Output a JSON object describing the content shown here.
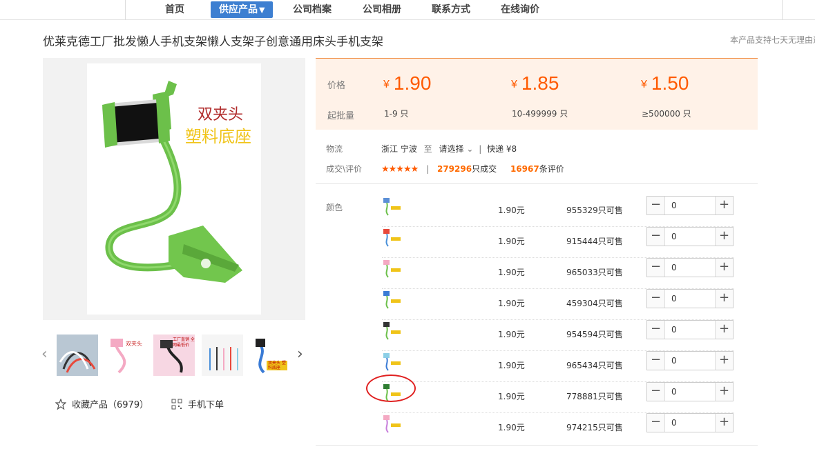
{
  "nav": {
    "items": [
      "首页",
      "供应产品",
      "公司档案",
      "公司相册",
      "联系方式",
      "在线询价"
    ],
    "active_arrow": "▼"
  },
  "product": {
    "title": "优莱克德工厂批发懒人手机支架懒人支架子创意通用床头手机支架",
    "side_note": "本产品支持七天无理由退"
  },
  "main_image": {
    "caption_line1": "双夹头",
    "caption_line2": "塑料底座"
  },
  "thumbnails": {
    "prev_icon": "chevron-left-icon",
    "next_icon": "chevron-right-icon",
    "thumb2_text": "双夹头",
    "thumb3_text": "工厂直销 全网最低价",
    "thumb5_text": "双夹头 塑料底座"
  },
  "actions": {
    "favorite_icon": "star-outline-icon",
    "favorite_label": "收藏产品（6979）",
    "mobile_icon": "qr-code-icon",
    "mobile_label": "手机下单"
  },
  "pricing": {
    "price_label": "价格",
    "min_label": "起批量",
    "currency": "¥",
    "tiers": [
      {
        "price": "1.90",
        "qty": "1-9 只"
      },
      {
        "price": "1.85",
        "qty": "10-499999 只"
      },
      {
        "price": "1.50",
        "qty": "≥500000 只"
      }
    ]
  },
  "logistics": {
    "label": "物流",
    "origin": "浙江 宁波",
    "to": "至",
    "destination": "请选择",
    "shipping": "快递 ¥8"
  },
  "deals": {
    "label": "成交\\评价",
    "stars": "★★★★★",
    "rating": 4.5,
    "sold_count": "279296",
    "sold_suffix": "只成交",
    "review_count": "16967",
    "review_suffix": "条评价"
  },
  "sku": {
    "label": "颜色",
    "rows": [
      {
        "price": "1.90元",
        "stock": "955329只可售",
        "qty": "0"
      },
      {
        "price": "1.90元",
        "stock": "915444只可售",
        "qty": "0"
      },
      {
        "price": "1.90元",
        "stock": "965033只可售",
        "qty": "0"
      },
      {
        "price": "1.90元",
        "stock": "459304只可售",
        "qty": "0"
      },
      {
        "price": "1.90元",
        "stock": "954594只可售",
        "qty": "0"
      },
      {
        "price": "1.90元",
        "stock": "965434只可售",
        "qty": "0"
      },
      {
        "price": "1.90元",
        "stock": "778881只可售",
        "qty": "0"
      },
      {
        "price": "1.90元",
        "stock": "974215只可售",
        "qty": "0"
      }
    ],
    "minus": "−",
    "plus": "+"
  },
  "colors": {
    "accent": "#ff5a00",
    "nav_active": "#3d7fd1",
    "highlight_circle": "#e02020"
  }
}
